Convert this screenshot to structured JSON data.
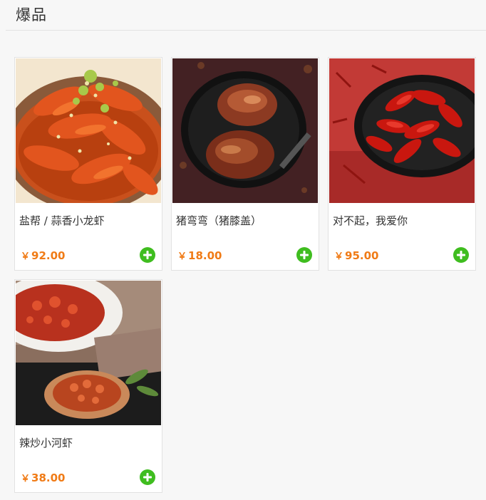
{
  "section": {
    "title": "爆品"
  },
  "currency_symbol": "￥",
  "products": [
    {
      "name": "盐帮 / 蒜香小龙虾",
      "price": "92.00",
      "image": "garlic-crayfish-photo"
    },
    {
      "name": "猪弯弯（猪膝盖）",
      "price": "18.00",
      "image": "pork-knuckle-photo"
    },
    {
      "name": "对不起，我爱你",
      "price": "95.00",
      "image": "spicy-crayfish-photo"
    },
    {
      "name": "辣炒小河虾",
      "price": "38.00",
      "image": "stir-fried-river-shrimp-photo"
    }
  ],
  "colors": {
    "price": "#f07b16",
    "add_button": "#3fbd1f",
    "background": "#f7f7f7"
  }
}
